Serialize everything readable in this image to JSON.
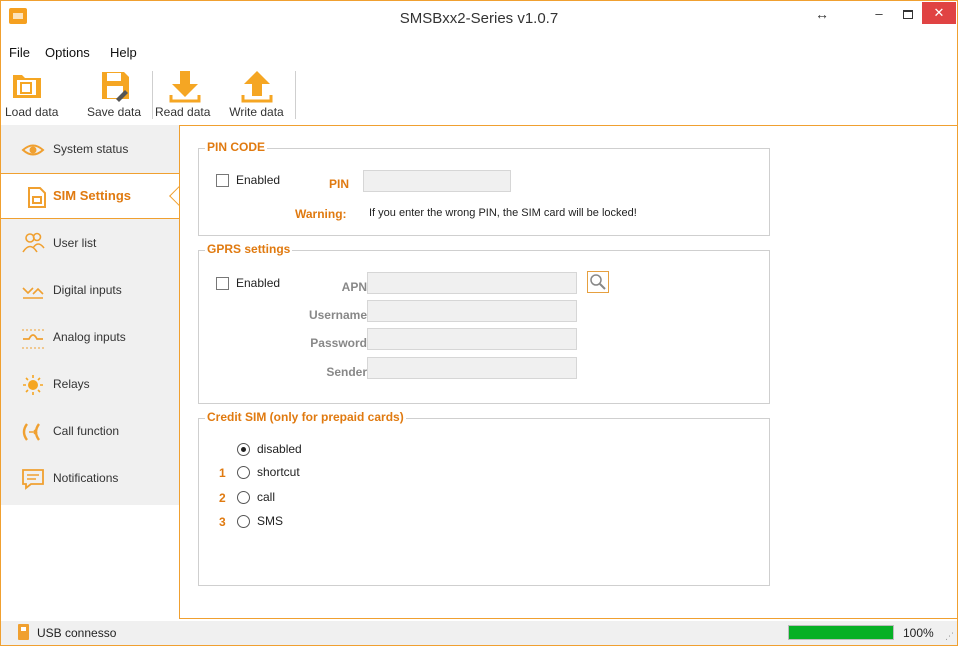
{
  "window": {
    "title": "SMSBxx2-Series v1.0.7",
    "resize_glyph": "↔",
    "minimize_glyph": "–",
    "close_glyph": "✕"
  },
  "menu": [
    "File",
    "Options",
    "Help"
  ],
  "toolbar": {
    "load": "Load data",
    "save": "Save data",
    "read": "Read data",
    "write": "Write data"
  },
  "sidebar": {
    "items": [
      {
        "label": "System status",
        "icon": "eye-icon"
      },
      {
        "label": "SIM Settings",
        "icon": "sim-card-icon"
      },
      {
        "label": "User list",
        "icon": "users-icon"
      },
      {
        "label": "Digital inputs",
        "icon": "digital-inputs-icon"
      },
      {
        "label": "Analog inputs",
        "icon": "analog-inputs-icon"
      },
      {
        "label": "Relays",
        "icon": "relay-bulb-icon"
      },
      {
        "label": "Call function",
        "icon": "call-function-icon"
      },
      {
        "label": "Notifications",
        "icon": "notifications-icon"
      }
    ],
    "active_index": 1
  },
  "pin": {
    "legend": "PIN CODE",
    "enabled_label": "Enabled",
    "enabled": false,
    "pin_label": "PIN",
    "pin_value": "",
    "warning_label": "Warning:",
    "warning_text": "If you enter the wrong PIN, the SIM card will be locked!"
  },
  "gprs": {
    "legend": "GPRS settings",
    "enabled_label": "Enabled",
    "enabled": false,
    "apn_label": "APN",
    "username_label": "Username",
    "password_label": "Password",
    "sender_label": "Sender",
    "apn_value": "",
    "username_value": "",
    "password_value": "",
    "sender_value": ""
  },
  "credit": {
    "legend": "Credit SIM (only for prepaid cards)",
    "options": [
      {
        "num": "",
        "label": "disabled",
        "checked": true
      },
      {
        "num": "1",
        "label": "shortcut",
        "checked": false
      },
      {
        "num": "2",
        "label": "call",
        "checked": false
      },
      {
        "num": "3",
        "label": "SMS",
        "checked": false
      }
    ]
  },
  "status": {
    "connection": "USB connesso",
    "progress_text": "100%",
    "progress_fraction": 1.0
  },
  "colors": {
    "accent": "#e07a10",
    "border": "#f0a030",
    "progress": "#06b025",
    "close": "#e04343"
  }
}
